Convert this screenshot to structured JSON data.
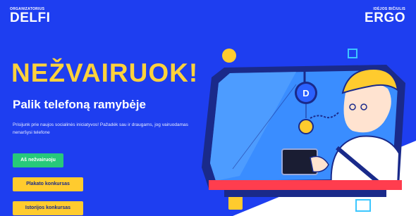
{
  "header": {
    "left_logo": {
      "caption": "ORGANIZATORIUS",
      "name": "DELFI"
    },
    "right_logo": {
      "caption": "IDĖJOS BIČIULIS",
      "name": "ERGO"
    }
  },
  "hero": {
    "headline": "NEŽVAIRUOK!",
    "subtitle": "Palik telefoną ramybėje",
    "description": "Prisijunk prie naujos socialinės iniciatyvos! Pažadėk sau ir draugams, jog vairuodamas nenaršysi telefone"
  },
  "buttons": {
    "pledge": "Aš nežvairuoju",
    "poster_contest": "Plakato konkursas",
    "story_contest": "Istorijos konkursas"
  },
  "colors": {
    "background": "#1e3ef0",
    "headline": "#ffd23c",
    "green_button": "#27c97a",
    "yellow_button": "#ffcb2e"
  },
  "illustration": {
    "badge_letter": "D",
    "icon": "driver-with-phone-illustration"
  }
}
